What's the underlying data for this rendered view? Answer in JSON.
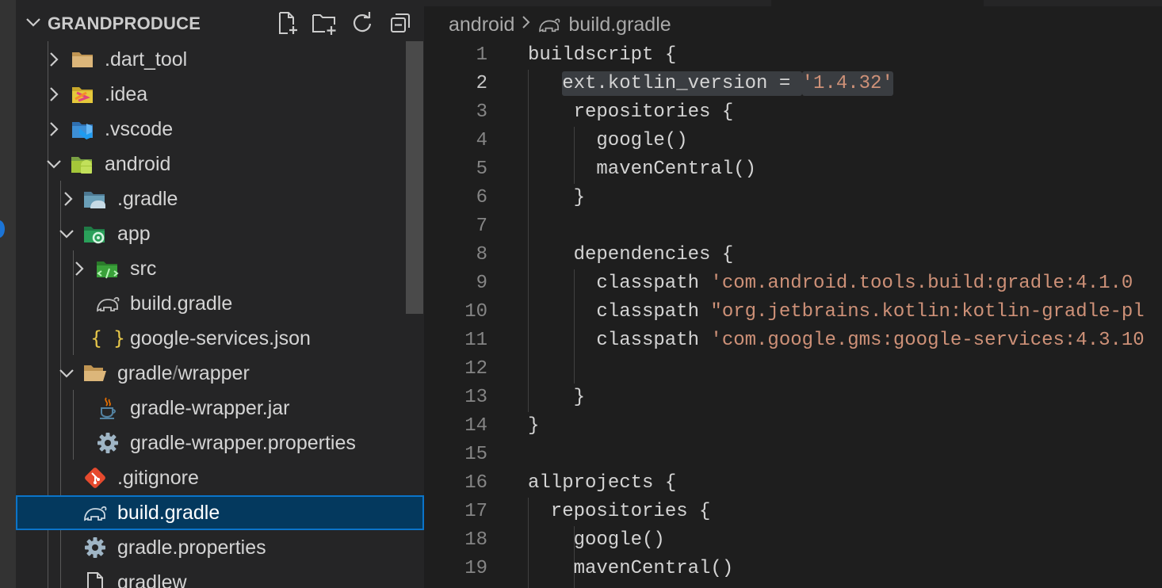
{
  "explorer": {
    "workspace_title": "GRANDPRODUCE",
    "header_actions": [
      "new-file-icon",
      "new-folder-icon",
      "refresh-icon",
      "collapse-all-icon"
    ],
    "tree": [
      {
        "label": ".dart_tool",
        "kind": "folder",
        "expanded": false,
        "icon": "folder-icon"
      },
      {
        "label": ".idea",
        "kind": "folder",
        "expanded": false,
        "icon": "idea-folder-icon"
      },
      {
        "label": ".vscode",
        "kind": "folder",
        "expanded": false,
        "icon": "vscode-folder-icon"
      },
      {
        "label": "android",
        "kind": "folder",
        "expanded": true,
        "icon": "android-folder-icon"
      },
      {
        "label": ".gradle",
        "kind": "folder",
        "expanded": false,
        "icon": "gradle-folder-icon"
      },
      {
        "label": "app",
        "kind": "folder",
        "expanded": true,
        "icon": "app-folder-icon"
      },
      {
        "label": "src",
        "kind": "folder",
        "expanded": false,
        "icon": "src-folder-icon"
      },
      {
        "label": "build.gradle",
        "kind": "file",
        "icon": "gradle-elephant-icon"
      },
      {
        "label": "google-services.json",
        "kind": "file",
        "icon": "json-braces-icon"
      },
      {
        "label_parts": [
          "gradle",
          "/",
          "wrapper"
        ],
        "kind": "folder",
        "expanded": true,
        "icon": "folder-open-icon"
      },
      {
        "label": "gradle-wrapper.jar",
        "kind": "file",
        "icon": "java-cup-icon"
      },
      {
        "label": "gradle-wrapper.properties",
        "kind": "file",
        "icon": "gear-icon"
      },
      {
        "label": ".gitignore",
        "kind": "file",
        "icon": "git-icon"
      },
      {
        "label": "build.gradle",
        "kind": "file",
        "icon": "gradle-elephant-icon",
        "selected": true
      },
      {
        "label": "gradle.properties",
        "kind": "file",
        "icon": "gear-icon"
      },
      {
        "label": "gradlew",
        "kind": "file",
        "icon": "file-icon"
      }
    ]
  },
  "editor": {
    "breadcrumb": {
      "folder": "android",
      "file": "build.gradle"
    },
    "active_line": 2,
    "lines": [
      {
        "n": "1",
        "parts": [
          {
            "t": "buildscript {"
          }
        ]
      },
      {
        "n": "2",
        "parts": [
          {
            "t": "ext.kotlin_version = ",
            "hl": true
          },
          {
            "t": "'1.4.32'",
            "s": true,
            "hl": true
          }
        ]
      },
      {
        "n": "3",
        "parts": [
          {
            "t": "repositories {"
          }
        ]
      },
      {
        "n": "4",
        "parts": [
          {
            "t": "google()"
          }
        ]
      },
      {
        "n": "5",
        "parts": [
          {
            "t": "mavenCentral()"
          }
        ]
      },
      {
        "n": "6",
        "parts": [
          {
            "t": "}"
          }
        ]
      },
      {
        "n": "7",
        "parts": []
      },
      {
        "n": "8",
        "parts": [
          {
            "t": "dependencies {"
          }
        ]
      },
      {
        "n": "9",
        "parts": [
          {
            "t": "classpath "
          },
          {
            "t": "'com.android.tools.build:gradle:4.1.0",
            "s": true
          }
        ]
      },
      {
        "n": "10",
        "parts": [
          {
            "t": "classpath "
          },
          {
            "t": "\"org.jetbrains.kotlin:kotlin-gradle-pl",
            "s": true
          }
        ]
      },
      {
        "n": "11",
        "parts": [
          {
            "t": "classpath "
          },
          {
            "t": "'com.google.gms:google-services:4.3.10",
            "s": true
          }
        ]
      },
      {
        "n": "12",
        "parts": []
      },
      {
        "n": "13",
        "parts": [
          {
            "t": "}"
          }
        ]
      },
      {
        "n": "14",
        "parts": [
          {
            "t": "}"
          }
        ]
      },
      {
        "n": "15",
        "parts": []
      },
      {
        "n": "16",
        "parts": [
          {
            "t": "allprojects {"
          }
        ]
      },
      {
        "n": "17",
        "parts": [
          {
            "t": "repositories {"
          }
        ]
      },
      {
        "n": "18",
        "parts": [
          {
            "t": "google()"
          }
        ]
      },
      {
        "n": "19",
        "parts": [
          {
            "t": "mavenCentral()"
          }
        ]
      }
    ]
  },
  "colors": {
    "sidebar_bg": "#252526",
    "editor_bg": "#1e1e1e",
    "selection_bg": "#04395e",
    "selection_border": "#0b74c9",
    "string": "#ce9178",
    "text": "#d4d4d4",
    "line_number": "#858585"
  }
}
